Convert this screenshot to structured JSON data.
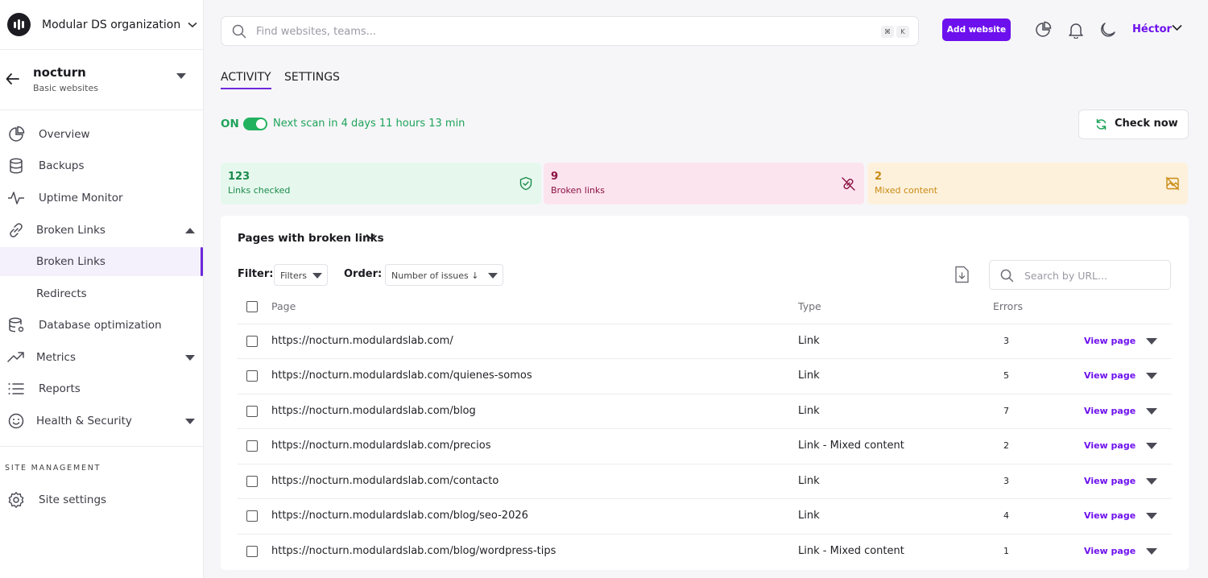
{
  "org": {
    "name": "Modular DS organization"
  },
  "site": {
    "name": "nocturn",
    "type": "Basic websites"
  },
  "sidebar": {
    "items": [
      {
        "label": "Overview"
      },
      {
        "label": "Backups"
      },
      {
        "label": "Uptime Monitor"
      },
      {
        "label": "Broken Links"
      },
      {
        "label": "Broken Links"
      },
      {
        "label": "Redirects"
      },
      {
        "label": "Database optimization"
      },
      {
        "label": "Metrics"
      },
      {
        "label": "Reports"
      },
      {
        "label": "Health & Security"
      }
    ],
    "section_label": "SITE MANAGEMENT",
    "settings_label": "Site settings"
  },
  "topbar": {
    "search_placeholder": "Find websites, teams...",
    "kbd_1": "⌘",
    "kbd_2": "K",
    "add_website": "Add website",
    "user": "Héctor"
  },
  "tabs": {
    "activity": "ACTIVITY",
    "settings": "SETTINGS"
  },
  "scan": {
    "on_label": "ON",
    "next_scan": "Next scan in 4 days 11 hours 13 min",
    "check_now": "Check now"
  },
  "stats": {
    "checked": {
      "value": "123",
      "label": "Links checked"
    },
    "broken": {
      "value": "9",
      "label": "Broken links"
    },
    "mixed": {
      "value": "2",
      "label": "Mixed content"
    }
  },
  "panel": {
    "title": "Pages with broken links",
    "filter_label": "Filter:",
    "filter_value": "Filters",
    "order_label": "Order:",
    "order_value": "Number of issues ↓",
    "search_placeholder": "Search by URL...",
    "columns": {
      "page": "Page",
      "type": "Type",
      "errors": "Errors"
    },
    "view_label": "View page",
    "rows": [
      {
        "url": "https://nocturn.modulardslab.com/",
        "type": "Link",
        "errors": "3"
      },
      {
        "url": "https://nocturn.modulardslab.com/quienes-somos",
        "type": "Link",
        "errors": "5"
      },
      {
        "url": "https://nocturn.modulardslab.com/blog",
        "type": "Link",
        "errors": "7"
      },
      {
        "url": "https://nocturn.modulardslab.com/precios",
        "type": "Link - Mixed content",
        "errors": "2"
      },
      {
        "url": "https://nocturn.modulardslab.com/contacto",
        "type": "Link",
        "errors": "3"
      },
      {
        "url": "https://nocturn.modulardslab.com/blog/seo-2026",
        "type": "Link",
        "errors": "4"
      },
      {
        "url": "https://nocturn.modulardslab.com/blog/wordpress-tips",
        "type": "Link - Mixed content",
        "errors": "1"
      }
    ]
  },
  "colors": {
    "accent": "#6d10ee",
    "success": "#1fa35a",
    "danger": "#8a1040",
    "warning": "#c98a12"
  }
}
